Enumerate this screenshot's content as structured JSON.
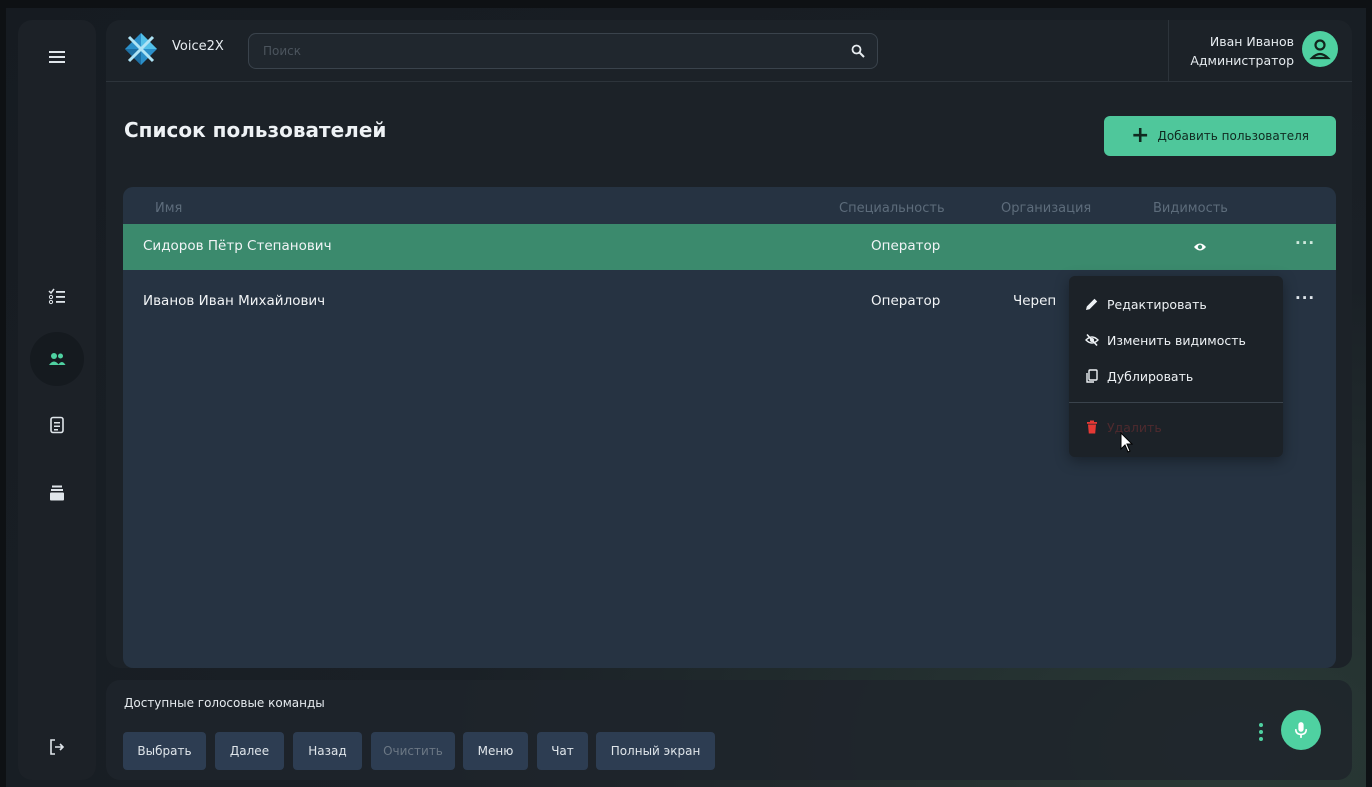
{
  "app": {
    "brand": "Voice2X"
  },
  "search": {
    "placeholder": "Поиск",
    "value": ""
  },
  "user": {
    "name": "Иван Иванов",
    "role": "Администратор"
  },
  "page": {
    "title": "Список пользователей",
    "add_button": "Добавить пользователя"
  },
  "table": {
    "headers": {
      "name": "Имя",
      "specialty": "Специальность",
      "organization": "Организация",
      "visibility": "Видимость"
    },
    "rows": [
      {
        "name": "Сидоров Пётр Степанович",
        "specialty": "Оператор",
        "organization": "",
        "visible_icon": "eye-icon",
        "selected": true
      },
      {
        "name": "Иванов Иван Михайлович",
        "specialty": "Оператор",
        "organization": "Череп",
        "visible_icon": "",
        "selected": false
      }
    ]
  },
  "context_menu": {
    "items": [
      {
        "label": "Редактировать",
        "icon": "pencil-icon"
      },
      {
        "label": "Изменить видимость",
        "icon": "eye-off-icon"
      },
      {
        "label": "Дублировать",
        "icon": "copy-icon"
      },
      {
        "label": "Удалить",
        "icon": "trash-icon"
      }
    ]
  },
  "sidebar": {
    "items": [
      {
        "icon": "hamburger-icon"
      },
      {
        "icon": "checklist-icon"
      },
      {
        "icon": "users-icon",
        "active": true
      },
      {
        "icon": "document-icon"
      },
      {
        "icon": "archive-icon"
      },
      {
        "icon": "logout-icon"
      }
    ]
  },
  "voice": {
    "title": "Доступные голосовые команды",
    "commands": [
      {
        "label": "Выбрать",
        "enabled": true
      },
      {
        "label": "Далее",
        "enabled": true
      },
      {
        "label": "Назад",
        "enabled": true
      },
      {
        "label": "Очистить",
        "enabled": false
      },
      {
        "label": "Меню",
        "enabled": true
      },
      {
        "label": "Чат",
        "enabled": true
      },
      {
        "label": "Полный экран",
        "enabled": true
      }
    ]
  },
  "colors": {
    "accent": "#4fd1a1",
    "selected_row": "#3b8a6d",
    "danger": "#e53935",
    "table_bg": "#263342"
  }
}
